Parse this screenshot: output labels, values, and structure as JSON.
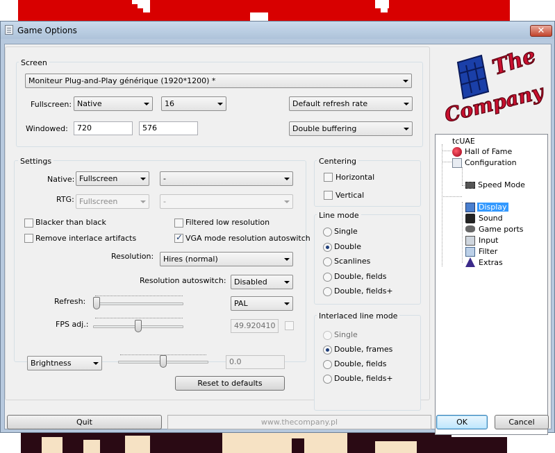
{
  "window": {
    "title": "Game Options"
  },
  "screen": {
    "group_title": "Screen",
    "monitor": "Moniteur Plug-and-Play générique (1920*1200) *",
    "fullscreen_label": "Fullscreen:",
    "fullscreen_mode": "Native",
    "fullscreen_depth": "16",
    "refresh_rate": "Default refresh rate",
    "windowed_label": "Windowed:",
    "windowed_width": "720",
    "windowed_height": "576",
    "buffering": "Double buffering"
  },
  "settings": {
    "group_title": "Settings",
    "native_label": "Native:",
    "native_mode": "Fullscreen",
    "native_extra": "-",
    "rtg_label": "RTG:",
    "rtg_mode": "Fullscreen",
    "rtg_extra": "-",
    "blacker_than_black": {
      "label": "Blacker than black",
      "checked": false
    },
    "filtered_low_res": {
      "label": "Filtered low resolution",
      "checked": false
    },
    "remove_interlace": {
      "label": "Remove interlace artifacts",
      "checked": false
    },
    "vga_autoswitch": {
      "label": "VGA mode resolution autoswitch",
      "checked": true
    },
    "resolution_label": "Resolution:",
    "resolution_value": "Hires (normal)",
    "autoswitch_label": "Resolution autoswitch:",
    "autoswitch_value": "Disabled",
    "refresh_label": "Refresh:",
    "refresh_value": "PAL",
    "refresh_slider_fraction": 0.0,
    "fps_label": "FPS adj.:",
    "fps_value": "49.920410",
    "fps_slider_fraction": 0.5,
    "fps_checked": false
  },
  "brightness": {
    "select": "Brightness",
    "value": "0.0",
    "slider_fraction": 0.5,
    "reset_label": "Reset to defaults"
  },
  "centering": {
    "group_title": "Centering",
    "horizontal": {
      "label": "Horizontal",
      "checked": false
    },
    "vertical": {
      "label": "Vertical",
      "checked": false
    }
  },
  "line_mode": {
    "group_title": "Line mode",
    "options": [
      "Single",
      "Double",
      "Scanlines",
      "Double, fields",
      "Double, fields+"
    ],
    "selected": "Double"
  },
  "interlaced_line_mode": {
    "group_title": "Interlaced line mode",
    "options": [
      "Single",
      "Double, frames",
      "Double, fields",
      "Double, fields+"
    ],
    "selected": "Double, frames",
    "disabled": [
      "Single"
    ]
  },
  "logo": {
    "line1": "The",
    "line2": "Company"
  },
  "tree": {
    "root": "tcUAE",
    "items": [
      "Hall of Fame",
      "Configuration",
      "Speed Mode",
      "Display",
      "Sound",
      "Game ports",
      "Input",
      "Filter",
      "Extras"
    ],
    "selected": "Display"
  },
  "footer": {
    "quit_label": "Quit",
    "website": "www.thecompany.pl",
    "ok_label": "OK",
    "cancel_label": "Cancel"
  },
  "colors": {
    "window_frame": "#b7c9de",
    "client_bg": "#f0f0f0",
    "logo_red": "#c8102e",
    "selection": "#3399ff"
  }
}
